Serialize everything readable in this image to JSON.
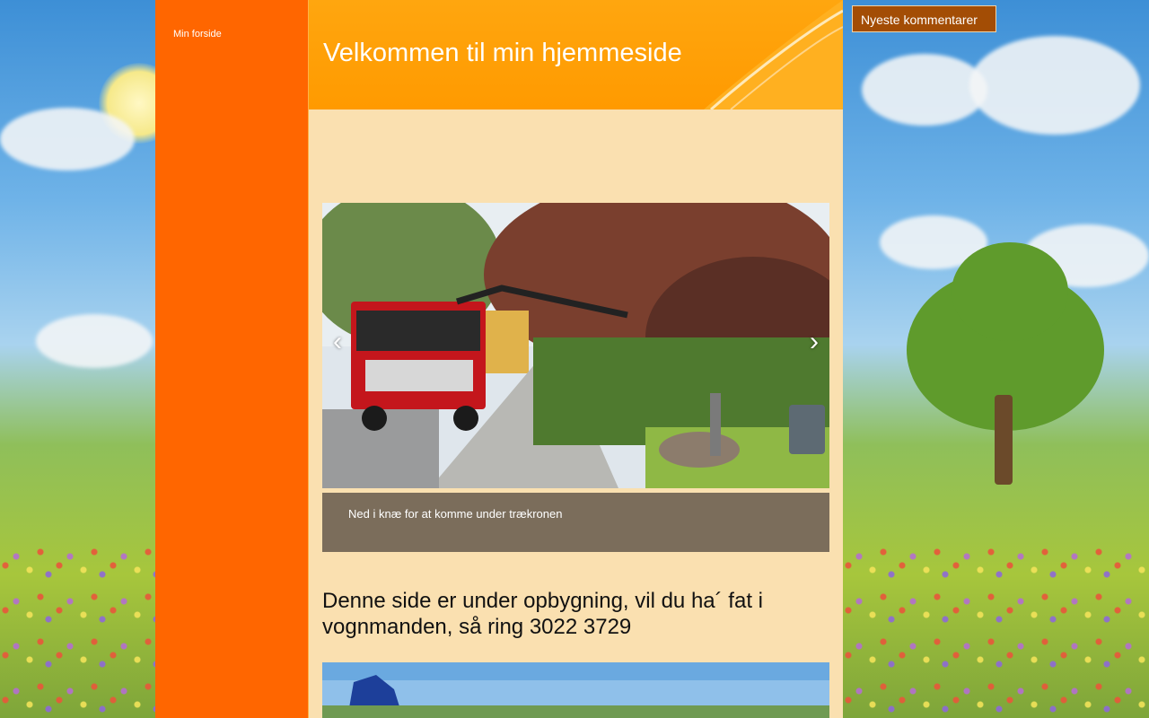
{
  "colors": {
    "nav_bg": "#ff6600",
    "header_bg": "#ff9a00",
    "content_bg": "#fae0b0",
    "caption_bg": "#7b6d5b",
    "widget_bg": "#a34d05"
  },
  "nav": {
    "items": [
      {
        "label": "Min forside"
      }
    ]
  },
  "header": {
    "title": "Velkommen til min hjemmeside"
  },
  "slider": {
    "prev_icon": "chevron-left-icon",
    "next_icon": "chevron-right-icon",
    "prev_symbol": "‹",
    "next_symbol": "›",
    "caption": "Ned i knæ for at komme under trækronen"
  },
  "content": {
    "heading": "Denne side er under opbygning, vil du ha´ fat i vognmanden, så ring 3022 3729"
  },
  "sidebar": {
    "widget_label": "Nyeste kommentarer"
  }
}
